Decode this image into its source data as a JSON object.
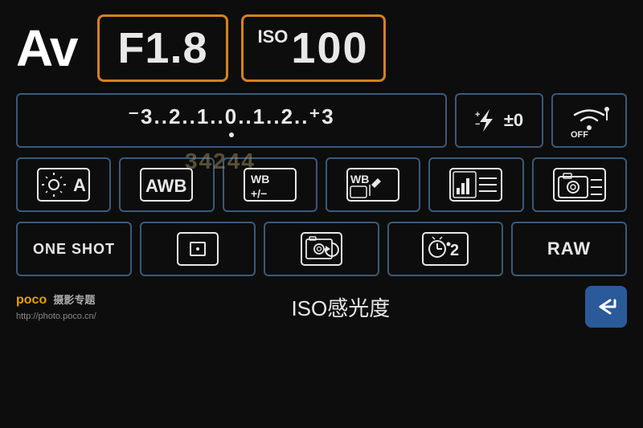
{
  "header": {
    "mode": "Av",
    "aperture": "F1.8",
    "iso_label": "ISO",
    "iso_value": "100"
  },
  "exposure": {
    "scale": "⁻3..2..1..0..1..2..⁺3",
    "flash_label": "±0",
    "wifi_label": "OFF"
  },
  "row2": {
    "cell1_label": "A",
    "cell2_label": "AWB",
    "cell3_label": "WB\n+/−",
    "cell4_label": "WB",
    "cell5_label": "histogram",
    "cell6_label": "camera-settings"
  },
  "row3": {
    "cell1_label": "ONE SHOT",
    "cell2_label": "metering-center",
    "cell3_label": "live-view",
    "cell4_label": "timer-2",
    "cell5_label": "RAW"
  },
  "footer": {
    "brand": "poco 摄影专题",
    "url": "http://photo.poco.cn/",
    "label": "ISO感光度",
    "back_label": "↩"
  },
  "watermark": "34244"
}
